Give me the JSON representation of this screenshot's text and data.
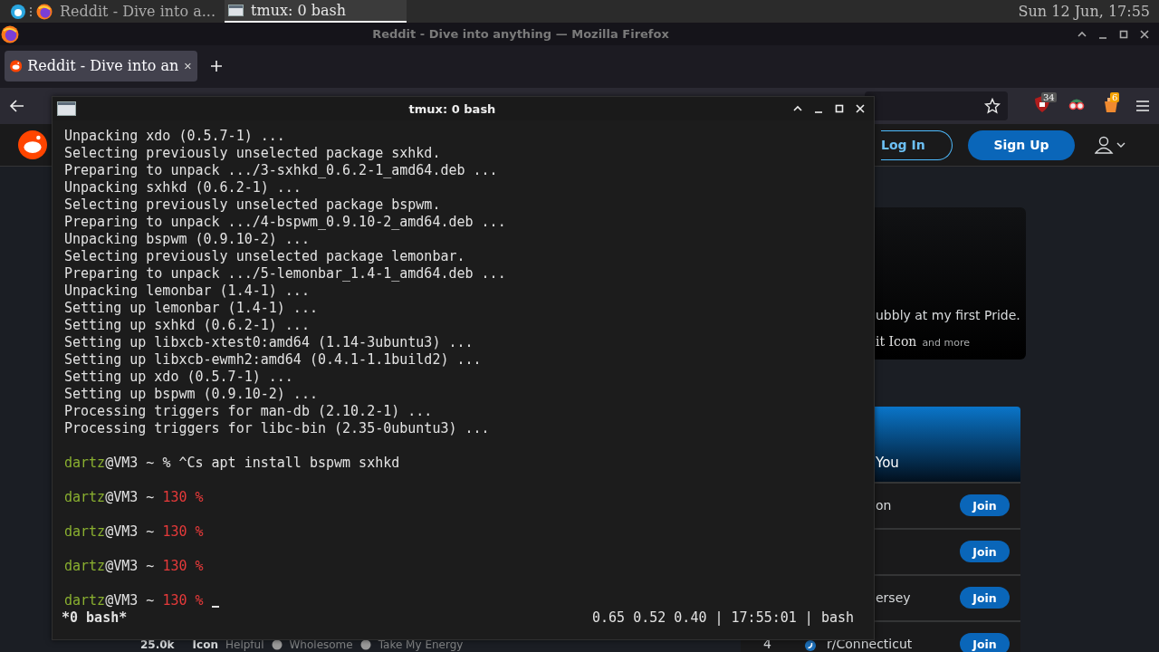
{
  "panel": {
    "taskbar": [
      {
        "kind": "browser",
        "label": "Reddit - Dive into a...",
        "selected": false
      },
      {
        "kind": "terminal",
        "label": "tmux: 0 bash",
        "selected": true
      }
    ],
    "clock": "Sun 12 Jun, 17:55"
  },
  "firefox": {
    "title": "Reddit - Dive into anything — Mozilla Firefox",
    "tabs": [
      {
        "label": "Reddit - Dive into an",
        "selected": true
      }
    ],
    "extensions": [
      {
        "kind": "shield",
        "badge": "34"
      },
      {
        "kind": "glasses"
      },
      {
        "kind": "bucket",
        "badge": "6"
      }
    ]
  },
  "reddit": {
    "header": {
      "login": "Log In",
      "signup": "Sign Up"
    },
    "feature_card": {
      "caption": "ubbly at my first Pride.",
      "title": "it Icon",
      "note": "and more"
    },
    "communities": {
      "title": "You",
      "rows": [
        {
          "name": "on",
          "button": "Join"
        },
        {
          "button": "Join"
        },
        {
          "name": "ersey",
          "button": "Join"
        },
        {
          "rank": "4",
          "name": "r/Connecticut",
          "button": "Join"
        }
      ]
    },
    "post_footer": {
      "score": "25.0k",
      "awards": [
        "Icon",
        "Helpful",
        "Wholesome",
        "Take My Energy"
      ]
    }
  },
  "terminal": {
    "title": "tmux: 0 bash",
    "lines": [
      {
        "kind": "output",
        "text": "Unpacking xdo (0.5.7-1) ..."
      },
      {
        "kind": "output",
        "text": "Selecting previously unselected package sxhkd."
      },
      {
        "kind": "output",
        "text": "Preparing to unpack .../3-sxhkd_0.6.2-1_amd64.deb ..."
      },
      {
        "kind": "output",
        "text": "Unpacking sxhkd (0.6.2-1) ..."
      },
      {
        "kind": "output",
        "text": "Selecting previously unselected package bspwm."
      },
      {
        "kind": "output",
        "text": "Preparing to unpack .../4-bspwm_0.9.10-2_amd64.deb ..."
      },
      {
        "kind": "output",
        "text": "Unpacking bspwm (0.9.10-2) ..."
      },
      {
        "kind": "output",
        "text": "Selecting previously unselected package lemonbar."
      },
      {
        "kind": "output",
        "text": "Preparing to unpack .../5-lemonbar_1.4-1_amd64.deb ..."
      },
      {
        "kind": "output",
        "text": "Unpacking lemonbar (1.4-1) ..."
      },
      {
        "kind": "output",
        "text": "Setting up lemonbar (1.4-1) ..."
      },
      {
        "kind": "output",
        "text": "Setting up sxhkd (0.6.2-1) ..."
      },
      {
        "kind": "output",
        "text": "Setting up libxcb-xtest0:amd64 (1.14-3ubuntu3) ..."
      },
      {
        "kind": "output",
        "text": "Setting up libxcb-ewmh2:amd64 (0.4.1-1.1build2) ..."
      },
      {
        "kind": "output",
        "text": "Setting up xdo (0.5.7-1) ..."
      },
      {
        "kind": "output",
        "text": "Setting up bspwm (0.9.10-2) ..."
      },
      {
        "kind": "output",
        "text": "Processing triggers for man-db (2.10.2-1) ..."
      },
      {
        "kind": "output",
        "text": "Processing triggers for libc-bin (2.35-0ubuntu3) ..."
      },
      {
        "kind": "blank"
      },
      {
        "kind": "prompt",
        "user": "dartz",
        "host": "@VM3 ~",
        "sign": "%",
        "failed": false,
        "command": "^Cs apt install bspwm sxhkd"
      },
      {
        "kind": "blank"
      },
      {
        "kind": "prompt",
        "user": "dartz",
        "host": "@VM3 ~",
        "sign": "130 %",
        "failed": true
      },
      {
        "kind": "blank"
      },
      {
        "kind": "prompt",
        "user": "dartz",
        "host": "@VM3 ~",
        "sign": "130 %",
        "failed": true
      },
      {
        "kind": "blank"
      },
      {
        "kind": "prompt",
        "user": "dartz",
        "host": "@VM3 ~",
        "sign": "130 %",
        "failed": true
      },
      {
        "kind": "blank"
      },
      {
        "kind": "prompt",
        "user": "dartz",
        "host": "@VM3 ~",
        "sign": "130 %",
        "failed": true
      }
    ],
    "cursor_visible": true,
    "status": {
      "left": "*0 bash*",
      "right": "0.65 0.52 0.40 | 17:55:01 | bash"
    }
  }
}
